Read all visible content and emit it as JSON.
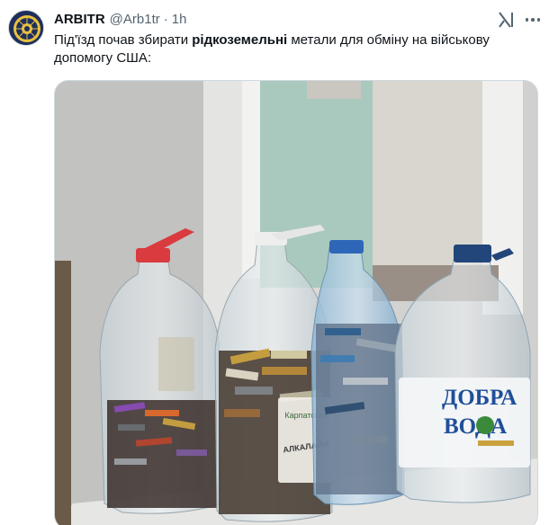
{
  "tweet": {
    "author_name": "ARBITR",
    "author_handle": "@Arb1tr",
    "separator": "·",
    "time": "1h",
    "text_before": "Під'їзд почав збирати ",
    "text_bold": "рідкоземельні",
    "text_after": " метали для обміну на військову допомогу США:",
    "more_icon": "more-horizontal-icon",
    "grok_icon": "grok-icon"
  },
  "media": {
    "photo_description_visible_labels": {
      "bottle_brand_line1": "ДОБРА",
      "bottle_brand_line2": "ВОДА",
      "battery_label": "АЛКАЛАЙН",
      "battery_brand": "Карпатська"
    },
    "colors": {
      "window_green": "#a9c9be",
      "wall": "#d9d9d7",
      "cap_red": "#d93b3f",
      "cap_blue": "#2e67b8",
      "cap_navy": "#23467a",
      "brand_blue": "#1f4f9a"
    }
  }
}
